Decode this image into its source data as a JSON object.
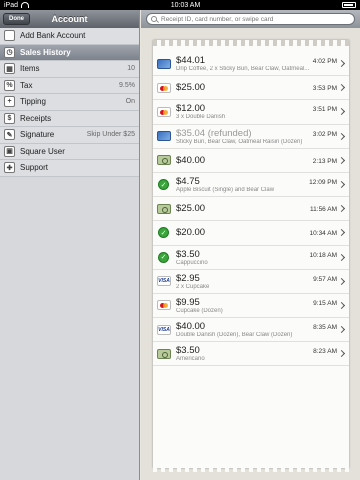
{
  "status_bar": {
    "carrier": "iPad",
    "time": "10:03 AM"
  },
  "sidebar": {
    "done_label": "Done",
    "title": "Account",
    "items": [
      {
        "label": "Add Bank Account",
        "value": "",
        "icon": "bank-icon"
      },
      {
        "label": "Sales History",
        "value": "",
        "icon": "clock-icon",
        "selected": true
      },
      {
        "label": "Items",
        "value": "10",
        "icon": "grid-icon"
      },
      {
        "label": "Tax",
        "value": "9.5%",
        "icon": "percent-icon"
      },
      {
        "label": "Tipping",
        "value": "On",
        "icon": "plus-icon"
      },
      {
        "label": "Receipts",
        "value": "",
        "icon": "dollar-icon"
      },
      {
        "label": "Signature",
        "value": "Skip Under $25",
        "icon": "pen-icon"
      },
      {
        "label": "Square User",
        "value": "",
        "icon": "user-icon"
      },
      {
        "label": "Support",
        "value": "",
        "icon": "lifebuoy-icon"
      }
    ]
  },
  "search": {
    "placeholder": "Receipt ID, card number, or swipe card"
  },
  "transactions": [
    {
      "amount": "$44.01",
      "time": "4:02 PM",
      "desc": "Drip Coffee, 2 x Sticky Bun, Bear Claw, Oatmeal...",
      "method": "card",
      "refunded": false
    },
    {
      "amount": "$25.00",
      "time": "3:53 PM",
      "desc": "",
      "method": "mastercard",
      "refunded": false
    },
    {
      "amount": "$12.00",
      "time": "3:51 PM",
      "desc": "3 x Double Danish",
      "method": "mastercard",
      "refunded": false
    },
    {
      "amount": "$35.04 (refunded)",
      "time": "3:02 PM",
      "desc": "Sticky Bun, Bear Claw, Oatmeal Raisin (Dozen)",
      "method": "card",
      "refunded": true
    },
    {
      "amount": "$40.00",
      "time": "2:13 PM",
      "desc": "",
      "method": "cash",
      "refunded": false
    },
    {
      "amount": "$4.75",
      "time": "12:09 PM",
      "desc": "Apple Biscuit (Single) and Bear Claw",
      "method": "check",
      "refunded": false
    },
    {
      "amount": "$25.00",
      "time": "11:56 AM",
      "desc": "",
      "method": "cash",
      "refunded": false
    },
    {
      "amount": "$20.00",
      "time": "10:34 AM",
      "desc": "",
      "method": "check",
      "refunded": false
    },
    {
      "amount": "$3.50",
      "time": "10:18 AM",
      "desc": "Cappuccino",
      "method": "check",
      "refunded": false
    },
    {
      "amount": "$2.95",
      "time": "9:57 AM",
      "desc": "2 x Cupcake",
      "method": "visa",
      "refunded": false
    },
    {
      "amount": "$9.95",
      "time": "9:15 AM",
      "desc": "Cupcake (Dozen)",
      "method": "mastercard",
      "refunded": false
    },
    {
      "amount": "$40.00",
      "time": "8:35 AM",
      "desc": "Double Danish (Dozen), Bear Claw (Dozen)",
      "method": "visa",
      "refunded": false
    },
    {
      "amount": "$3.50",
      "time": "8:23 AM",
      "desc": "Americano",
      "method": "cash",
      "refunded": false
    }
  ]
}
